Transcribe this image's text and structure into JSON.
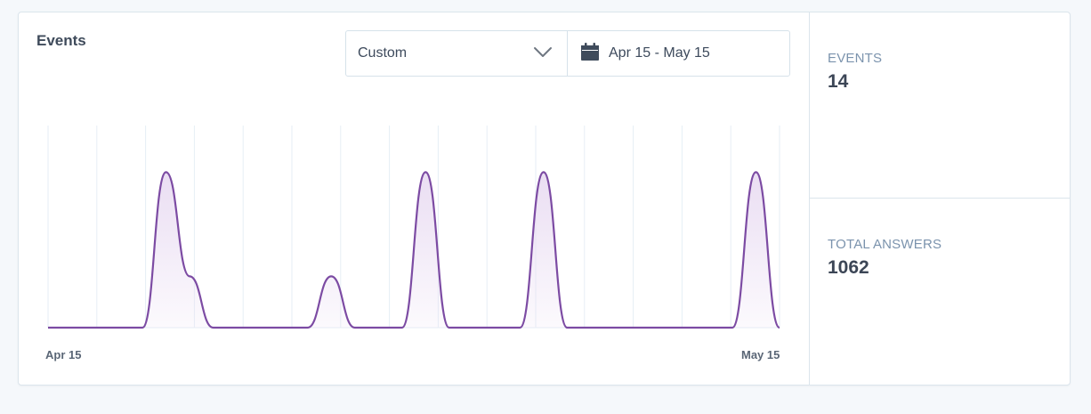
{
  "panel": {
    "title": "Events"
  },
  "filter": {
    "select_value": "Custom",
    "date_range": "Apr 15 - May 15"
  },
  "icons": {
    "select": "chevron-down-icon",
    "date": "calendar-icon"
  },
  "colors": {
    "line": "#7c4ba3",
    "fill": "#e9dcf2",
    "grid": "#e6eef5",
    "label": "#7b93ad"
  },
  "chart_data": {
    "type": "area",
    "x_start_label": "Apr 15",
    "x_end_label": "May 15",
    "grid": "vertical",
    "points": 32,
    "series": [
      {
        "values": [
          0,
          0,
          0,
          0,
          0,
          1,
          0.33,
          0,
          0,
          0,
          0,
          0,
          0.33,
          0,
          0,
          0,
          1,
          0,
          0,
          0,
          0,
          1,
          0,
          0,
          0,
          0,
          0,
          0,
          0,
          0,
          1,
          0
        ]
      }
    ],
    "ylim": [
      0,
      1.3
    ]
  },
  "stats": [
    {
      "label": "EVENTS",
      "value": "14"
    },
    {
      "label": "TOTAL ANSWERS",
      "value": "1062"
    }
  ]
}
